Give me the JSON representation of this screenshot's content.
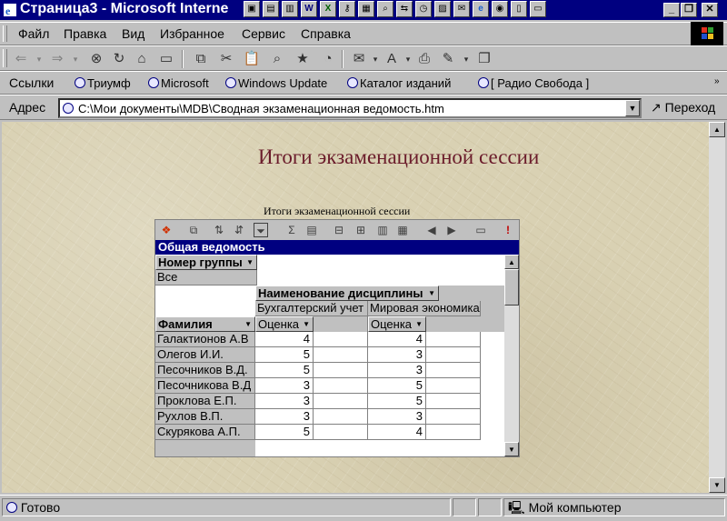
{
  "window": {
    "title": "Страница3 - Microsoft Interne"
  },
  "menu": [
    "Файл",
    "Правка",
    "Вид",
    "Избранное",
    "Сервис",
    "Справка"
  ],
  "links": {
    "label": "Ссылки",
    "items": [
      "Триумф",
      "Microsoft",
      "Windows Update",
      "Каталог изданий",
      "[ Радио Свобода ]"
    ]
  },
  "address": {
    "label": "Адрес",
    "value": "C:\\Мои документы\\MDB\\Сводная экзаменационная ведомость.htm",
    "go_label": "Переход"
  },
  "page": {
    "title": "Итоги экзаменационной сессии",
    "caption": "Итоги экзаменационной сессии"
  },
  "pivot": {
    "title": "Общая ведомость",
    "filter_field": "Номер группы",
    "filter_value": "Все",
    "column_field": "Наименование дисциплины",
    "row_field": "Фамилия",
    "subjects": [
      "Бухгалтерский учет",
      "Мировая экономика"
    ],
    "measure": "Оценка",
    "rows": [
      {
        "name": "Галактионов А.В",
        "values": [
          4,
          4
        ]
      },
      {
        "name": "Олегов И.И.",
        "values": [
          5,
          3
        ]
      },
      {
        "name": "Песочников В.Д.",
        "values": [
          5,
          3
        ]
      },
      {
        "name": "Песочникова В.Д",
        "values": [
          3,
          5
        ]
      },
      {
        "name": "Проклова Е.П.",
        "values": [
          3,
          5
        ]
      },
      {
        "name": "Рухлов В.П.",
        "values": [
          3,
          3
        ]
      },
      {
        "name": "Скурякова А.П.",
        "values": [
          5,
          4
        ]
      }
    ]
  },
  "status": {
    "text": "Готово",
    "zone": "Мой компьютер"
  },
  "colors": {
    "titlebar": "#000080",
    "page_title": "#6a1b2a",
    "chrome": "#c0c0c0"
  }
}
